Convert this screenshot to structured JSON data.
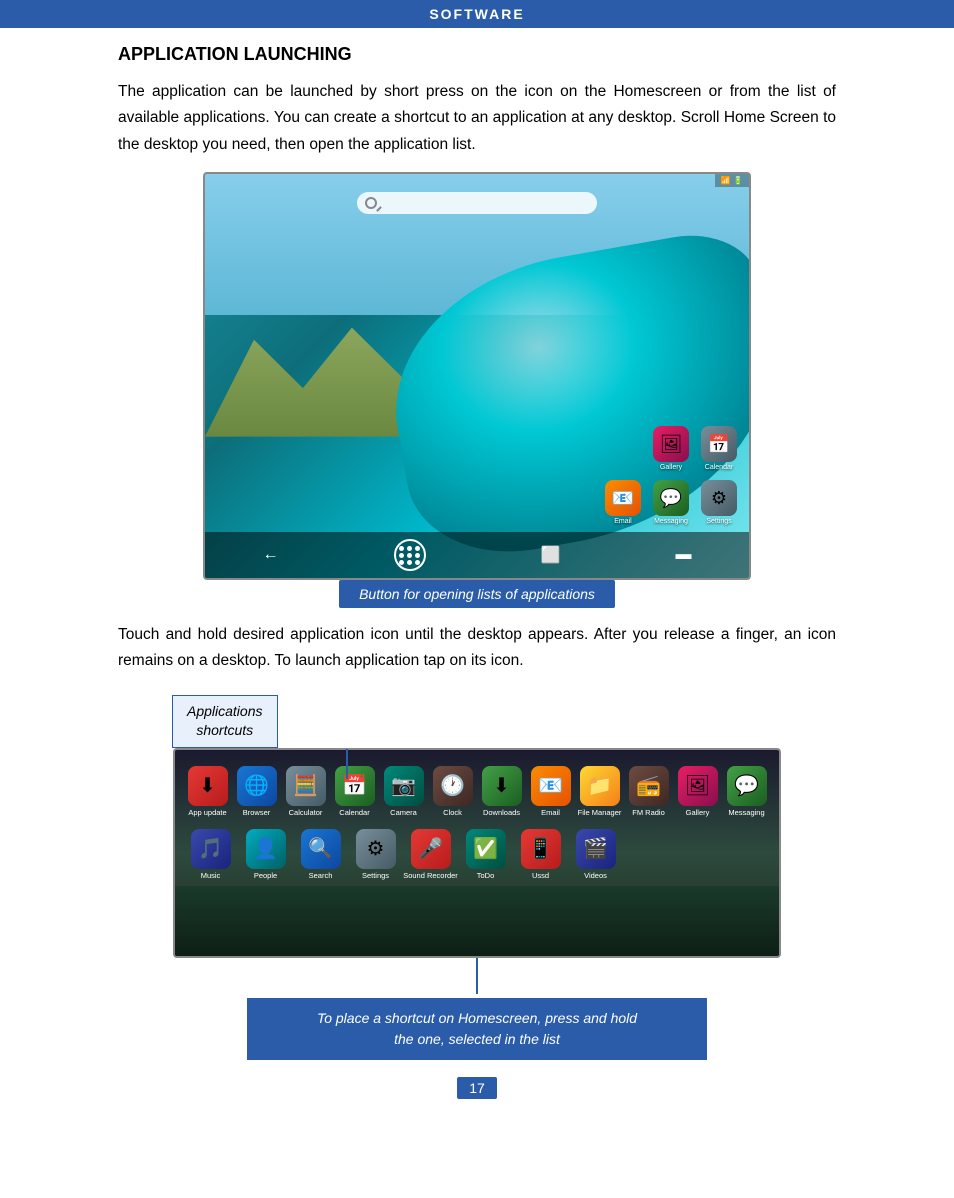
{
  "header": {
    "title": "SOFTWARE"
  },
  "page": {
    "section_title": "APPLICATION LAUNCHING",
    "paragraph1": "The application can be launched by short press on the icon on the Homescreen or from the list of available applications. You can create a shortcut to an application at any desktop. Scroll Home Screen to the desktop you need, then open the application list.",
    "caption1": "Button for opening lists of applications",
    "paragraph2": "Touch and hold desired application icon until the desktop appears. After you release a finger, an icon remains on a desktop. To launch application tap on its icon.",
    "annotation_label_line1": "Applications",
    "annotation_label_line2": "shortcuts",
    "caption2_line1": "To place a shortcut on Homescreen, press and hold",
    "caption2_line2": "the one, selected in the list",
    "page_number": "17"
  },
  "phone_apps": [
    {
      "label": "Gallery",
      "icon": "🖼",
      "color": "icon-pink"
    },
    {
      "label": "Calendar",
      "icon": "📅",
      "color": "icon-gray"
    }
  ],
  "phone_apps2": [
    {
      "label": "Email",
      "icon": "📧",
      "color": "icon-orange"
    },
    {
      "label": "Messaging",
      "icon": "💬",
      "color": "icon-green"
    },
    {
      "label": "Settings",
      "icon": "⚙",
      "color": "icon-gray"
    }
  ],
  "app_list_row1": [
    {
      "label": "App update",
      "icon": "⬇",
      "color": "icon-red"
    },
    {
      "label": "Browser",
      "icon": "🌐",
      "color": "icon-blue"
    },
    {
      "label": "Calculator",
      "icon": "🧮",
      "color": "icon-gray"
    },
    {
      "label": "Calendar",
      "icon": "📅",
      "color": "icon-green"
    },
    {
      "label": "Camera",
      "icon": "📷",
      "color": "icon-teal"
    },
    {
      "label": "Clock",
      "icon": "🕐",
      "color": "icon-brown"
    },
    {
      "label": "Downloads",
      "icon": "⬇",
      "color": "icon-green"
    },
    {
      "label": "Email",
      "icon": "📧",
      "color": "icon-orange"
    },
    {
      "label": "File Manager",
      "icon": "📁",
      "color": "icon-yellow"
    },
    {
      "label": "FM Radio",
      "icon": "📻",
      "color": "icon-brown"
    },
    {
      "label": "Gallery",
      "icon": "🖼",
      "color": "icon-pink"
    },
    {
      "label": "Messaging",
      "icon": "💬",
      "color": "icon-green"
    }
  ],
  "app_list_row2": [
    {
      "label": "Music",
      "icon": "🎵",
      "color": "icon-indigo"
    },
    {
      "label": "People",
      "icon": "👤",
      "color": "icon-cyan"
    },
    {
      "label": "Search",
      "icon": "🔍",
      "color": "icon-blue"
    },
    {
      "label": "Settings",
      "icon": "⚙",
      "color": "icon-gray"
    },
    {
      "label": "Sound Recorder",
      "icon": "🎤",
      "color": "icon-red"
    },
    {
      "label": "ToDo",
      "icon": "✅",
      "color": "icon-teal"
    },
    {
      "label": "Ussd",
      "icon": "📱",
      "color": "icon-red"
    },
    {
      "label": "Videos",
      "icon": "🎬",
      "color": "icon-indigo"
    }
  ]
}
